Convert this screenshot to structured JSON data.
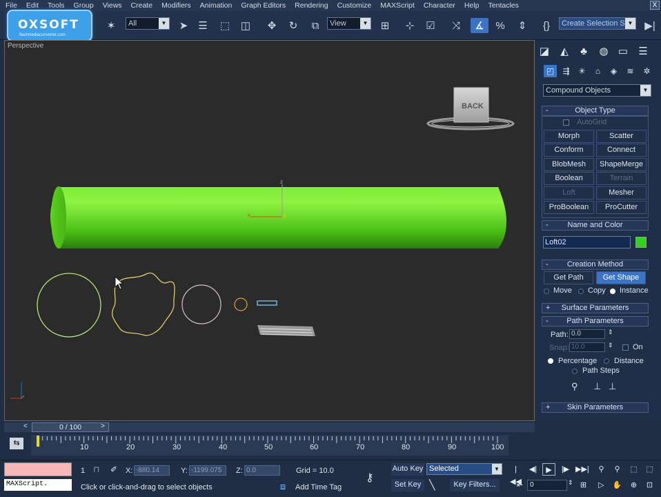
{
  "logo": {
    "text": "OXSOFT",
    "subtext": "flashmediaconverter.com"
  },
  "menu": [
    "File",
    "Edit",
    "Tools",
    "Group",
    "Views",
    "Create",
    "Modifiers",
    "Animation",
    "Graph Editors",
    "Rendering",
    "Customize",
    "MAXScript",
    "Character",
    "Help",
    "Tentacles"
  ],
  "window": {
    "close_label": "X"
  },
  "toolbar": {
    "filter_select": "All",
    "ref_coord_select": "View",
    "named_selection_placeholder": "Create Selection Set",
    "icons": [
      "undo-icon",
      "redo-icon",
      "link-icon",
      "unlink-icon",
      "bind-space-warp-icon",
      "select-object-icon",
      "select-by-name-icon",
      "rectangular-selection-icon",
      "window-crossing-icon",
      "move-icon",
      "rotate-icon",
      "scale-icon",
      "pivot-icon",
      "select-manipulate-icon",
      "keyboard-shortcut-icon",
      "snap-icon",
      "angle-snap-icon",
      "percent-snap-icon",
      "spinner-snap-icon",
      "edit-named-sets-icon"
    ]
  },
  "viewport": {
    "label": "Perspective",
    "viewcube_label": "BACK",
    "axis_labels": {
      "x": "x",
      "y": "y",
      "z": "z"
    },
    "object_color": "#5cd31e"
  },
  "command_panel": {
    "category": "Compound Objects",
    "object_type": {
      "title": "Object Type",
      "autogrid": "AutoGrid",
      "buttons": [
        {
          "label": "Morph",
          "enabled": true
        },
        {
          "label": "Scatter",
          "enabled": true
        },
        {
          "label": "Conform",
          "enabled": true
        },
        {
          "label": "Connect",
          "enabled": true
        },
        {
          "label": "BlobMesh",
          "enabled": true
        },
        {
          "label": "ShapeMerge",
          "enabled": true
        },
        {
          "label": "Boolean",
          "enabled": true
        },
        {
          "label": "Terrain",
          "enabled": false
        },
        {
          "label": "Loft",
          "enabled": false
        },
        {
          "label": "Mesher",
          "enabled": true
        },
        {
          "label": "ProBoolean",
          "enabled": true
        },
        {
          "label": "ProCutter",
          "enabled": true
        }
      ]
    },
    "name_color": {
      "title": "Name and Color",
      "name": "Loft02",
      "color": "#36d020"
    },
    "creation_method": {
      "title": "Creation Method",
      "get_path": "Get Path",
      "get_shape": "Get Shape",
      "move": "Move",
      "copy": "Copy",
      "instance": "Instance"
    },
    "surface_parameters": {
      "title": "Surface Parameters"
    },
    "path_parameters": {
      "title": "Path Parameters",
      "path_label": "Path:",
      "path_value": "0.0",
      "snap_label": "Snap:",
      "snap_value": "10.0",
      "on_label": "On",
      "percentage": "Percentage",
      "distance": "Distance",
      "path_steps": "Path Steps"
    },
    "skin_parameters": {
      "title": "Skin Parameters"
    }
  },
  "timeline": {
    "slider": "0 / 100",
    "ticks": [
      "10",
      "20",
      "30",
      "40",
      "50",
      "60",
      "70",
      "80",
      "90",
      "100"
    ]
  },
  "status": {
    "maxscript_label": "MAXScript.",
    "selected_count": "1",
    "x_label": "X:",
    "x_value": "-880.14",
    "y_label": "Y:",
    "y_value": "-1199.075",
    "z_label": "Z:",
    "z_value": "0.0",
    "grid": "Grid = 10.0",
    "prompt": "Click or click-and-drag to select objects",
    "add_time_tag": "Add Time Tag",
    "auto_key": "Auto Key",
    "set_key": "Set Key",
    "selection_mode": "Selected",
    "key_filters": "Key Filters...",
    "frame": "0"
  }
}
